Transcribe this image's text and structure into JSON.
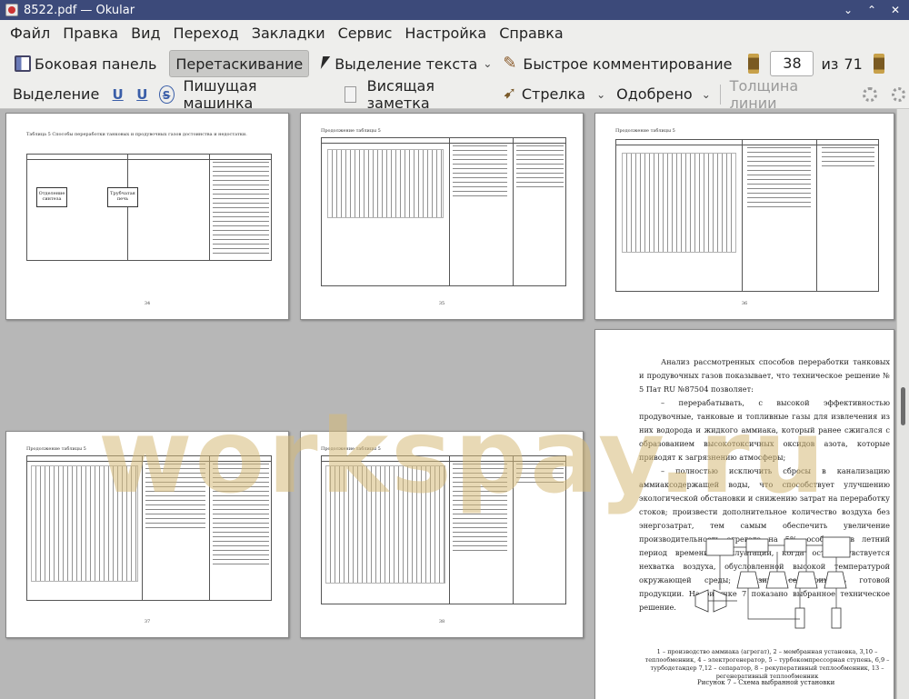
{
  "window": {
    "title": "8522.pdf — Okular",
    "controls": [
      "⌄",
      "⌃",
      "✕"
    ]
  },
  "menu": [
    "Файл",
    "Правка",
    "Вид",
    "Переход",
    "Закладки",
    "Сервис",
    "Настройка",
    "Справка"
  ],
  "toolbar": {
    "sidebar": "Боковая панель",
    "drag": "Перетаскивание",
    "text_select": "Выделение текста",
    "quick_comment": "Быстрое комментирование",
    "page_current": "38",
    "page_of": "из",
    "page_total": "71"
  },
  "annotation_bar": {
    "highlight": "Выделение",
    "underline1": "U",
    "underline2": "U",
    "strike": "S",
    "typewriter": "Пишущая машинка",
    "popup_note": "Висящая заметка",
    "arrow": "Стрелка",
    "stamp": "Одобрено",
    "line_width": "Толщина линии"
  },
  "pages": {
    "p34": {
      "num": "34",
      "caption": "Таблица 5 Способы переработки танковых и продувочных газов достоинства и недостатки.",
      "block1": "Отделение синтеза",
      "block2": "Трубчатая печь"
    },
    "p35": {
      "num": "35",
      "caption": "Продолжение таблицы 5"
    },
    "p36": {
      "num": "36",
      "caption": "Продолжение таблицы 5"
    },
    "p37": {
      "num": "37",
      "caption": "Продолжение таблицы 5"
    },
    "p38": {
      "num": "38",
      "caption": "Продолжение таблицы 5"
    },
    "p39": {
      "para1": "Анализ рассмотренных способов переработки танковых и продувочных газов показывает, что техническое решение № 5 Пат RU №87504 позволяет:",
      "para2": "– перерабатывать, с высокой эффективностью продувочные, танковые и топливные газы для извлечения из них водорода и жидкого аммиака, который ранее сжигался с образованием высокотоксичных оксидов азота, которые приводят к загрязнению атмосферы;",
      "para3": "– полностью исключить сбросы в канализацию аммиаксодержащей воды, что способствует улучшению экологической обстановки и снижению затрат на переработку стоков; произвести дополнительное количество воздуха без энергозатрат, тем самым обеспечить увеличение производительность агрегата на 5%, особенно в летний период времени эксплуатации, когда остро чувствуется нехватка воздуха, обусловленной высокой температурой окружающей среды; снизить себестоимость готовой продукции. На рисунке 7 показано выбранное техническое решение.",
      "fig_caption": "1 – производство аммиака (агрегат), 2 – мембранная установка, 3,10 – теплообменник, 4 – электрогенератор, 5 – турбокомпрессорная ступень, 6,9 – турбодетандер 7,12 – сепаратор, 8 – рекуперативный теплообменник, 13 – регенеративный теплообменник",
      "fig_title": "Рисунок 7 – Схема выбранной установки"
    }
  },
  "watermark": "workspay.ru"
}
